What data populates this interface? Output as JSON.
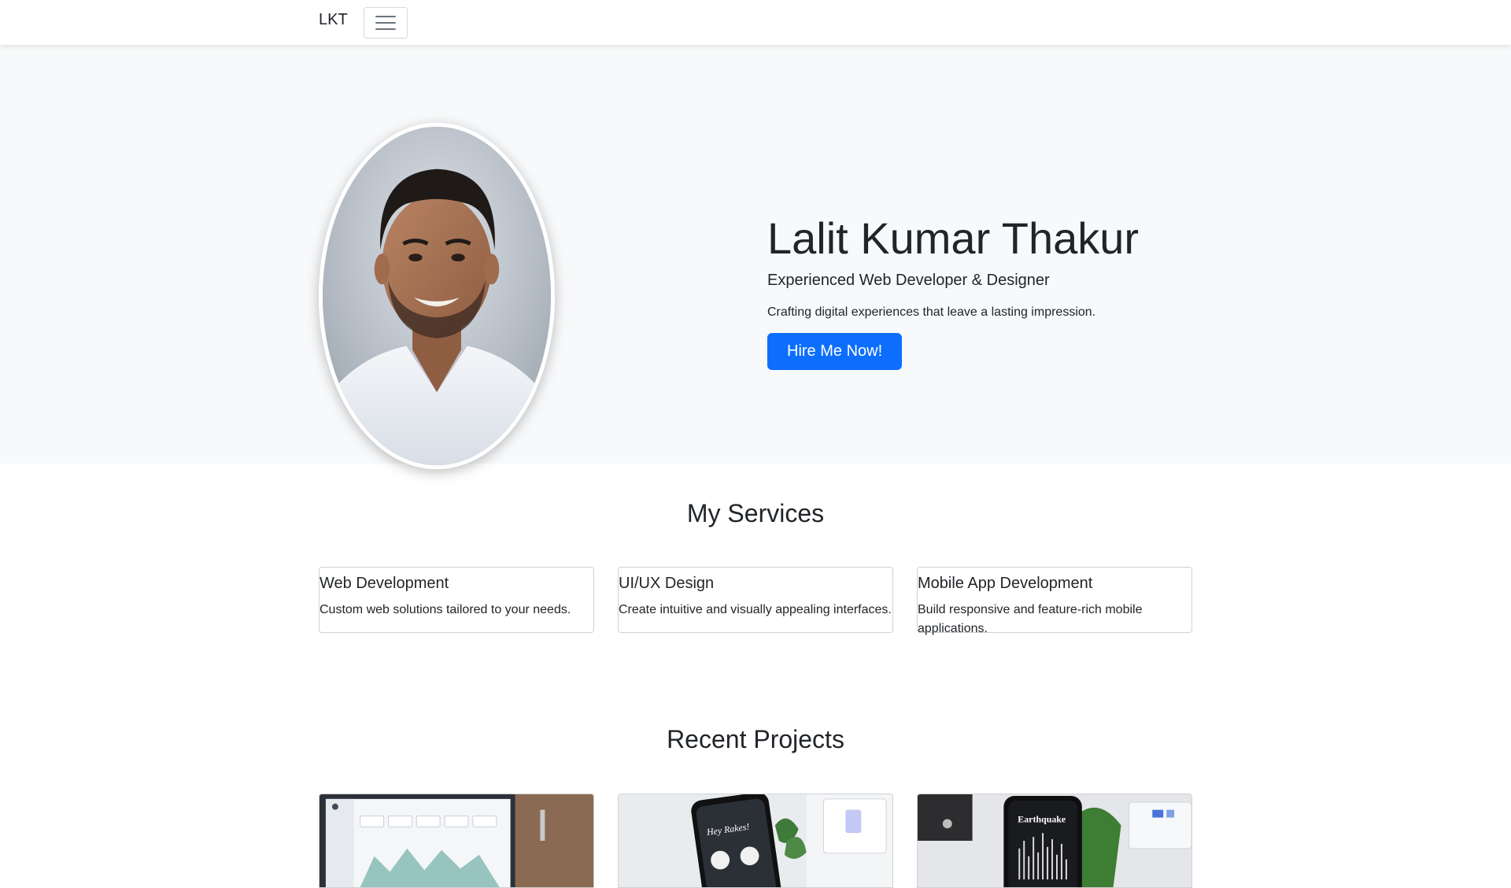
{
  "nav": {
    "brand": "LKT",
    "toggle_icon": "hamburger-menu-icon"
  },
  "hero": {
    "portrait_alt": "Portrait of Lalit Kumar Thakur",
    "name": "Lalit Kumar Thakur",
    "role": "Experienced Web Developer & Designer",
    "tagline": "Crafting digital experiences that leave a lasting impression.",
    "cta_label": "Hire Me Now!",
    "cta_color": "#0d6efd",
    "background": "#f8f9fa"
  },
  "services": {
    "title": "My Services",
    "items": [
      {
        "title": "Web Development",
        "text": "Custom web solutions tailored to your needs."
      },
      {
        "title": "UI/UX Design",
        "text": "Create intuitive and visually appealing interfaces."
      },
      {
        "title": "Mobile App Development",
        "text": "Build responsive and feature-rich mobile applications."
      }
    ]
  },
  "projects": {
    "title": "Recent Projects",
    "items": [
      {
        "image": "dashboard-laptop-image"
      },
      {
        "image": "banking-app-phone-image",
        "phone_text": "Hey Rakes!"
      },
      {
        "image": "earthquake-app-phone-image",
        "phone_text": "Earthquake"
      }
    ]
  }
}
